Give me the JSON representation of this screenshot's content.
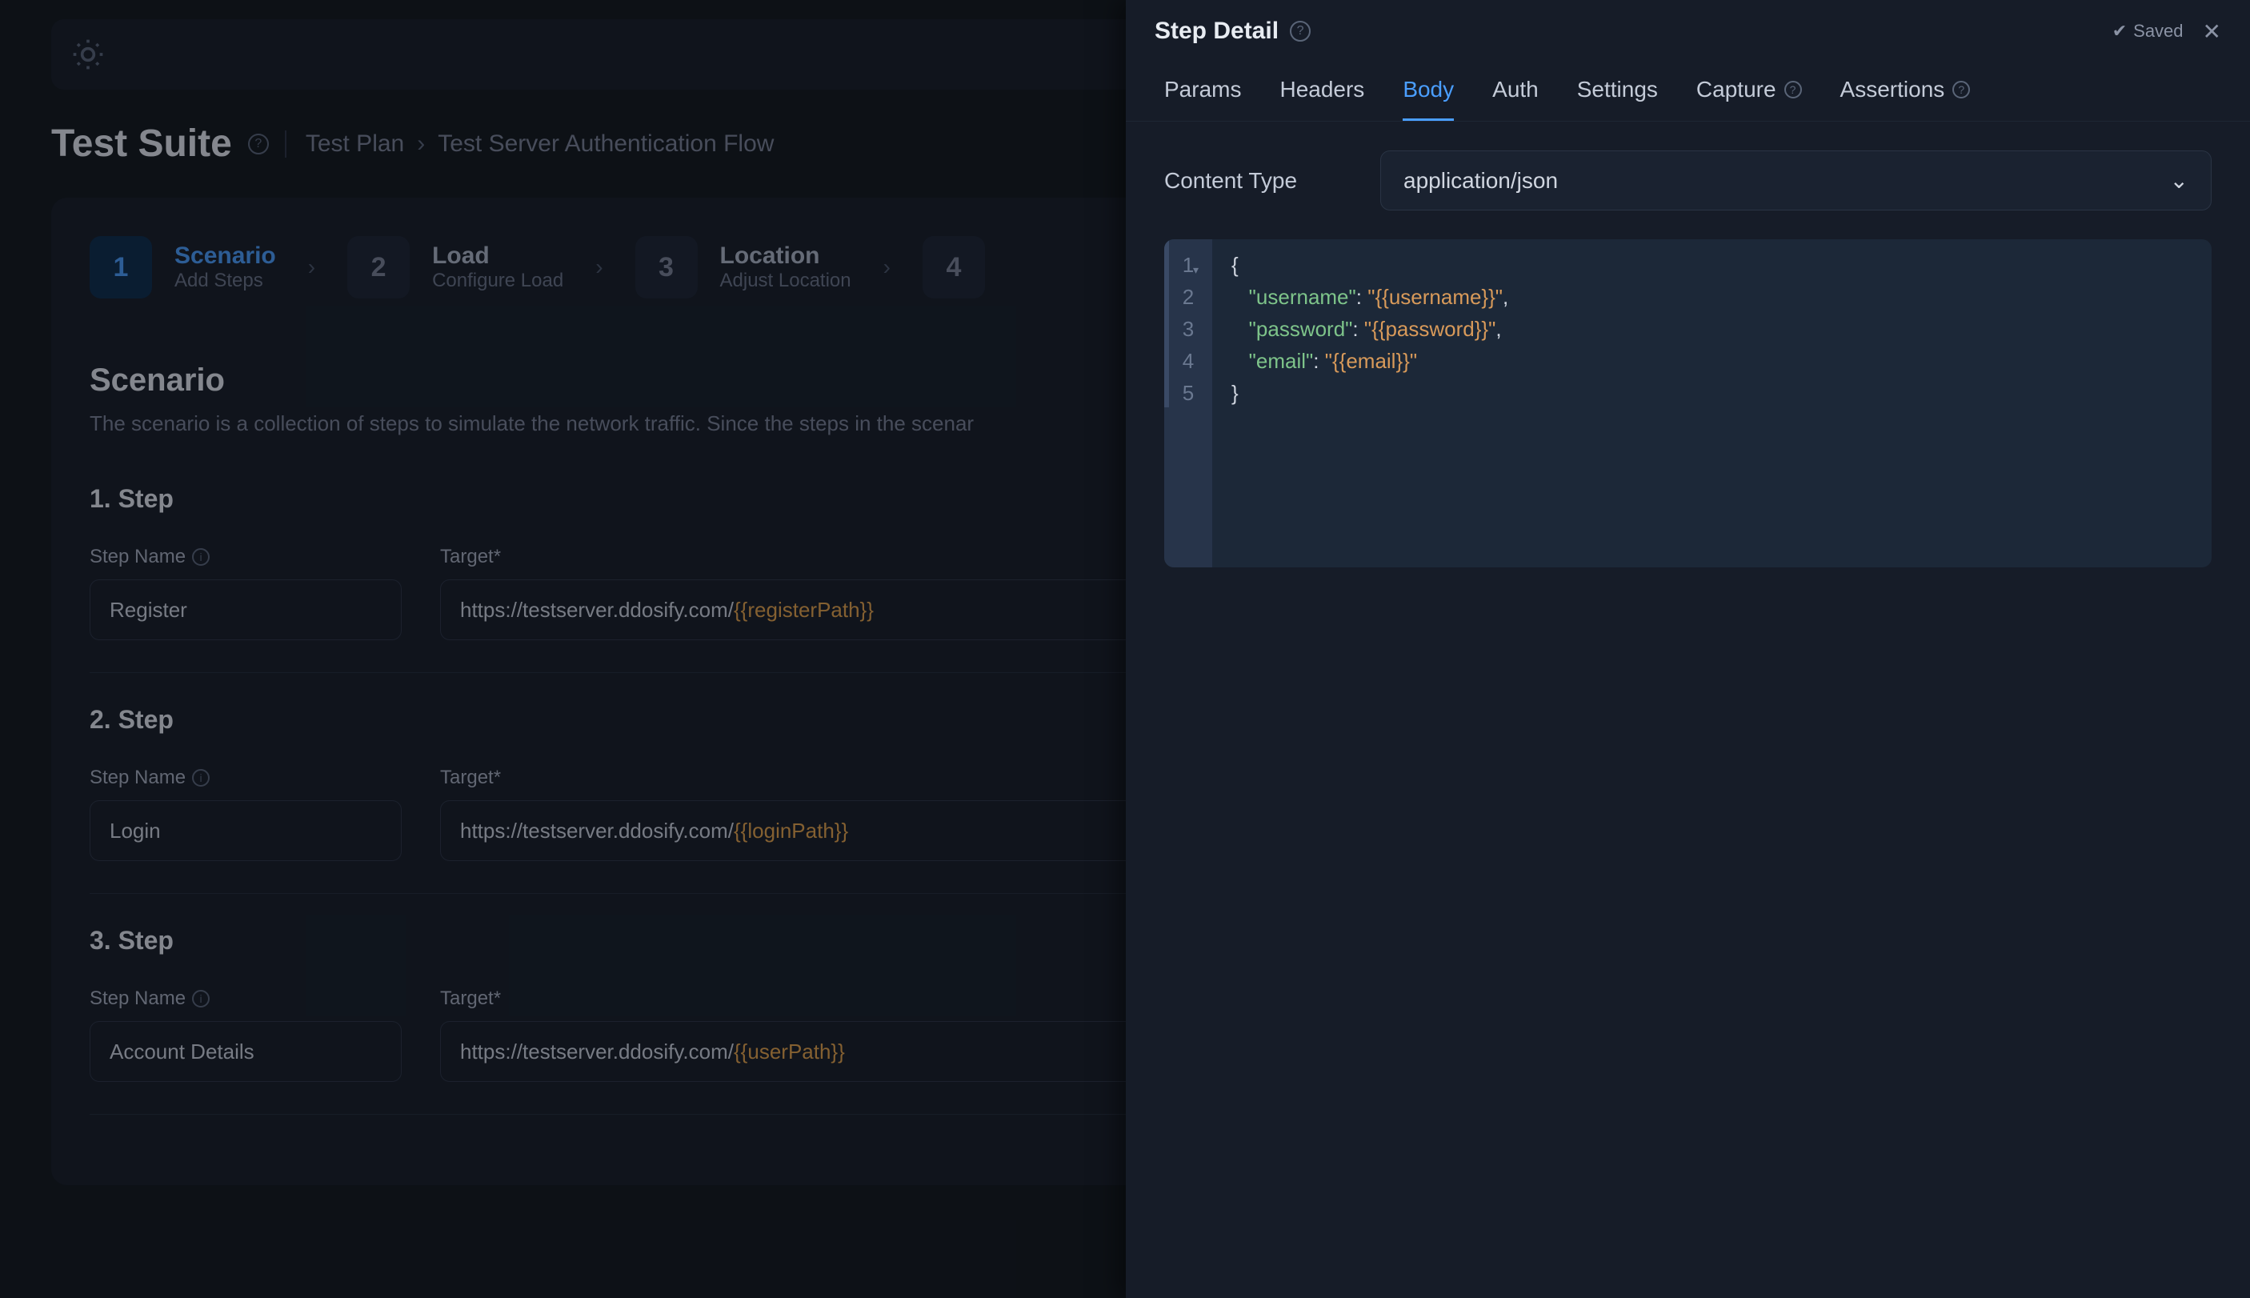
{
  "header": {
    "page_title": "Test Suite",
    "breadcrumb": [
      "Test Plan",
      "Test Server Authentication Flow"
    ]
  },
  "stepper": [
    {
      "num": "1",
      "title": "Scenario",
      "sub": "Add Steps",
      "active": true
    },
    {
      "num": "2",
      "title": "Load",
      "sub": "Configure Load",
      "active": false
    },
    {
      "num": "3",
      "title": "Location",
      "sub": "Adjust Location",
      "active": false
    },
    {
      "num": "4",
      "title": "",
      "sub": "",
      "active": false
    }
  ],
  "scenario": {
    "title": "Scenario",
    "desc": "The scenario is a collection of steps to simulate the network traffic. Since the steps in the scenar"
  },
  "steps": [
    {
      "heading": "1. Step",
      "name_label": "Step Name",
      "name_value": "Register",
      "target_label": "Target*",
      "target_base": "https://testserver.ddosify.com/",
      "target_var": "{{registerPath}}"
    },
    {
      "heading": "2. Step",
      "name_label": "Step Name",
      "name_value": "Login",
      "target_label": "Target*",
      "target_base": "https://testserver.ddosify.com/",
      "target_var": "{{loginPath}}"
    },
    {
      "heading": "3. Step",
      "name_label": "Step Name",
      "name_value": "Account Details",
      "target_label": "Target*",
      "target_base": "https://testserver.ddosify.com/",
      "target_var": "{{userPath}}"
    }
  ],
  "panel": {
    "title": "Step Detail",
    "saved": "Saved",
    "tabs": [
      "Params",
      "Headers",
      "Body",
      "Auth",
      "Settings",
      "Capture",
      "Assertions"
    ],
    "active_tab": "Body",
    "content_type_label": "Content Type",
    "content_type_value": "application/json",
    "code": {
      "lines": [
        "1",
        "2",
        "3",
        "4",
        "5"
      ],
      "body": [
        {
          "indent": 0,
          "type": "brace",
          "text": "{"
        },
        {
          "indent": 1,
          "type": "kv",
          "key": "\"username\"",
          "val": "\"{{username}}\"",
          "comma": ","
        },
        {
          "indent": 1,
          "type": "kv",
          "key": "\"password\"",
          "val": "\"{{password}}\"",
          "comma": ","
        },
        {
          "indent": 1,
          "type": "kv",
          "key": "\"email\"",
          "val": "\"{{email}}\"",
          "comma": ""
        },
        {
          "indent": 0,
          "type": "brace",
          "text": "}"
        }
      ]
    }
  }
}
